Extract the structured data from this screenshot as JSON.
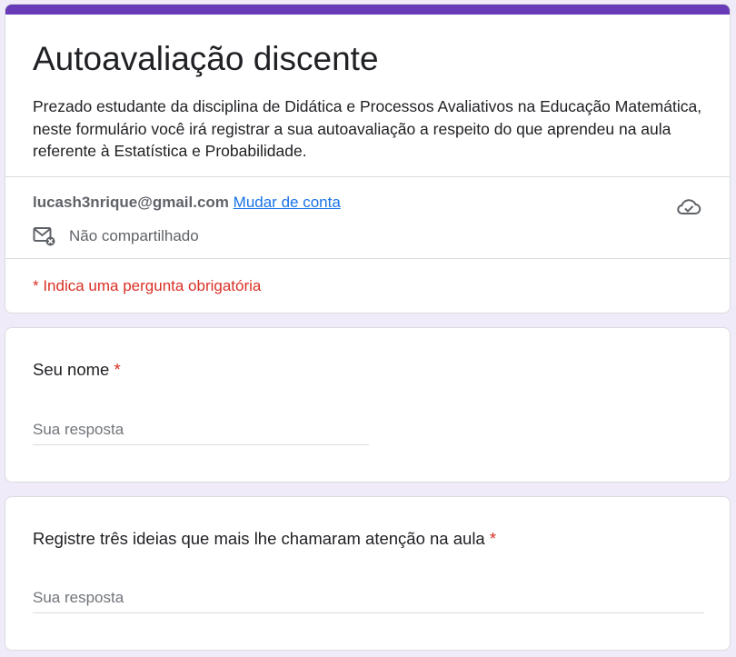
{
  "form": {
    "title": "Autoavaliação discente",
    "description": "Prezado estudante da disciplina de Didática e Processos Avaliativos na Educação Matemática, neste formulário você irá registrar a sua autoavaliação a respeito do que aprendeu na aula referente à Estatística e Probabilidade.",
    "account": {
      "email": "lucash3nrique@gmail.com",
      "switch_label": "Mudar de conta",
      "not_shared_label": "Não compartilhado",
      "cloud_icon": "cloud-check-icon",
      "mail_icon": "mail-not-shared-icon"
    },
    "required_note": "* Indica uma pergunta obrigatória",
    "accent_color": "#673ab7",
    "required_color": "#d93025"
  },
  "questions": [
    {
      "label": "Seu nome",
      "required_mark": "*",
      "placeholder": "Sua resposta"
    },
    {
      "label": "Registre três ideias que mais lhe chamaram atenção na aula",
      "required_mark": "*",
      "placeholder": "Sua resposta"
    }
  ]
}
